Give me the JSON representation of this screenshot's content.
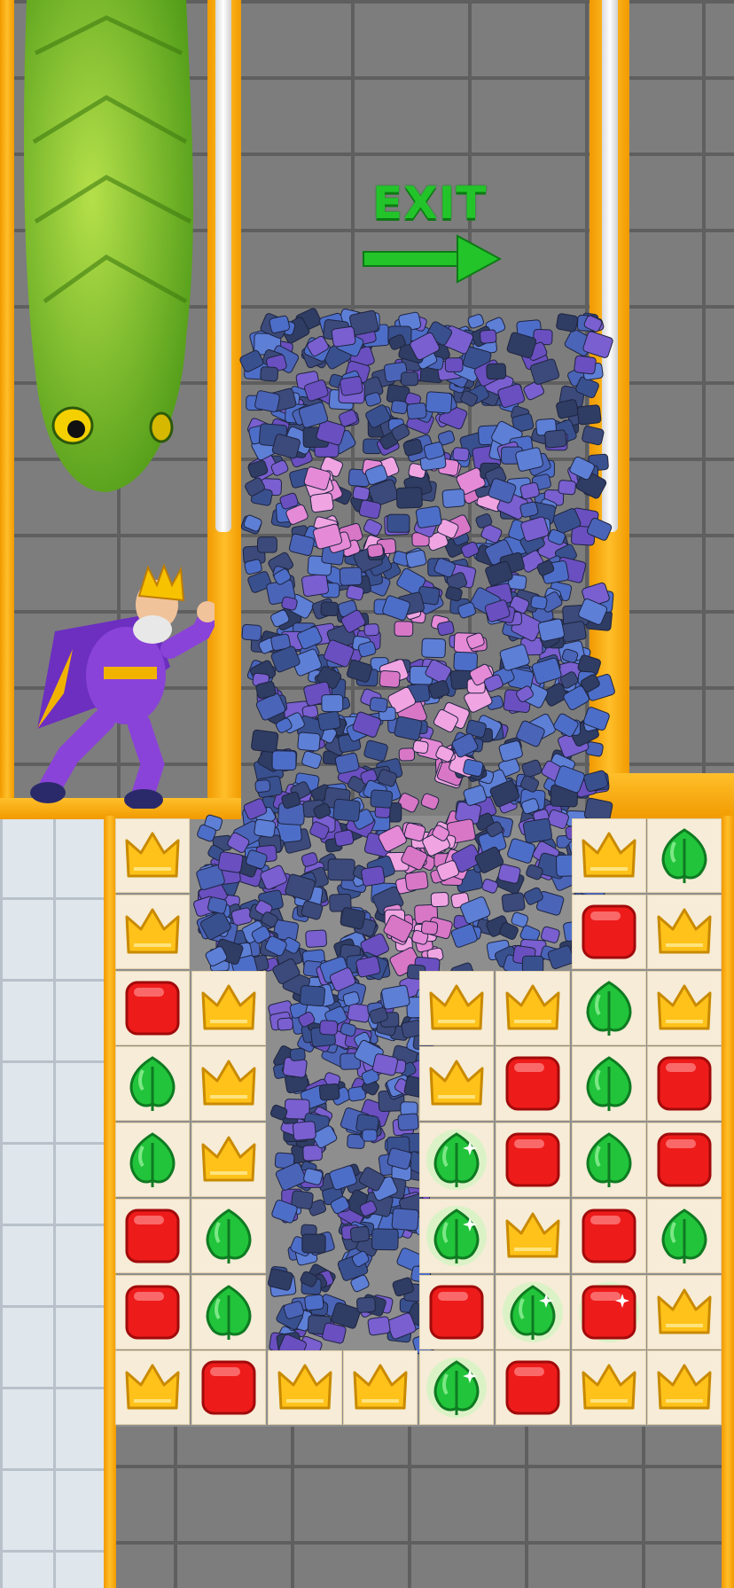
{
  "exit": {
    "label": "EXIT",
    "arrow_icon": "right-arrow-icon",
    "color": "#22c42a"
  },
  "characters": {
    "hero": "king-icon",
    "enemy": "snake-icon"
  },
  "board": {
    "columns": 8,
    "rows": 8,
    "cells": [
      [
        "crown",
        "empty",
        "empty",
        "empty",
        "empty",
        "empty",
        "crown",
        "leaf"
      ],
      [
        "crown",
        "empty",
        "empty",
        "empty",
        "empty",
        "empty",
        "red",
        "crown"
      ],
      [
        "red",
        "crown",
        "empty",
        "empty",
        "crown",
        "crown",
        "leaf",
        "crown"
      ],
      [
        "leaf",
        "crown",
        "empty",
        "empty",
        "crown",
        "red",
        "leaf",
        "red"
      ],
      [
        "leaf",
        "crown",
        "empty",
        "empty",
        "leaf-sparkle",
        "red",
        "leaf",
        "red"
      ],
      [
        "red",
        "leaf",
        "empty",
        "empty",
        "leaf-sparkle",
        "crown",
        "red",
        "leaf"
      ],
      [
        "red",
        "leaf",
        "empty",
        "empty",
        "red",
        "leaf-sparkle",
        "red-sparkle",
        "crown"
      ],
      [
        "crown",
        "red",
        "crown",
        "crown",
        "leaf-sparkle",
        "red",
        "crown",
        "crown"
      ]
    ],
    "piece_colors": {
      "crown": "#ffc21a",
      "leaf": "#21c43a",
      "red": "#ee1b1b"
    }
  }
}
